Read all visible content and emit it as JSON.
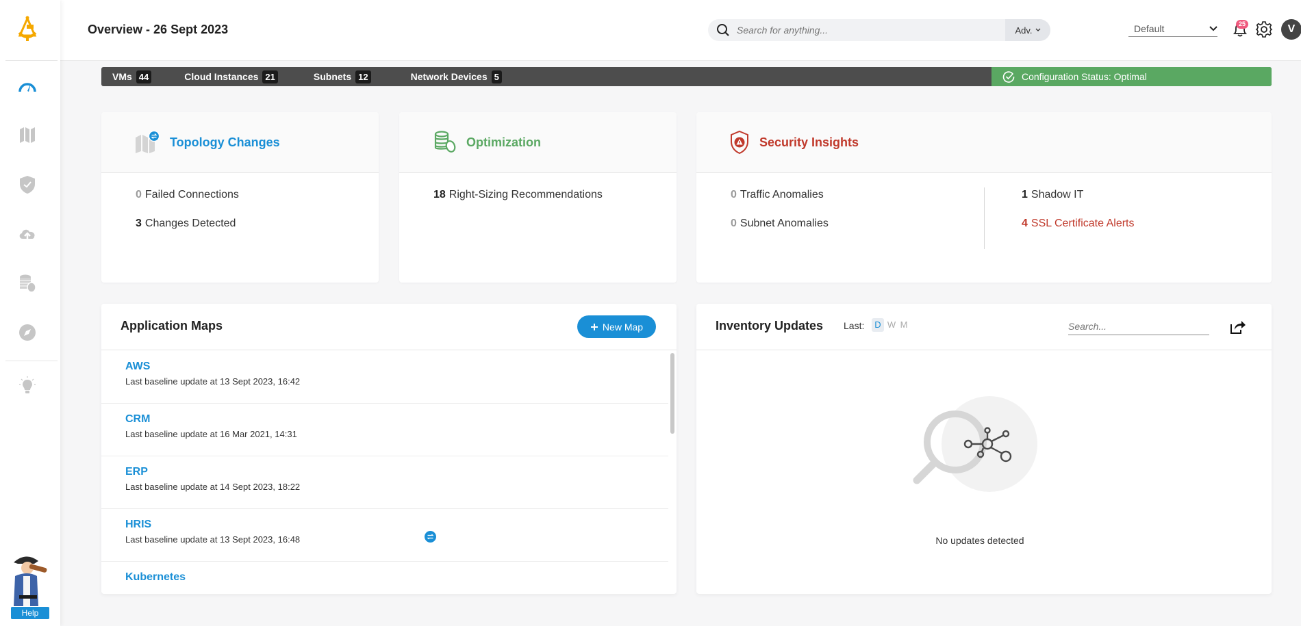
{
  "header": {
    "title": "Overview - 26 Sept 2023",
    "search_placeholder": "Search for anything...",
    "adv_label": "Adv.",
    "profile_select": "Default",
    "notification_count": "25",
    "avatar_initial": "V"
  },
  "sidebar": {
    "items": [
      {
        "icon": "dashboard-gauge-icon",
        "active": true
      },
      {
        "icon": "map-icon"
      },
      {
        "icon": "shield-check-icon"
      },
      {
        "icon": "cloud-upload-icon"
      },
      {
        "icon": "coins-icon"
      },
      {
        "icon": "compass-icon"
      },
      {
        "icon": "lightbulb-icon"
      }
    ],
    "help_label": "Help"
  },
  "stats_bar": {
    "items": [
      {
        "label": "VMs",
        "count": "44"
      },
      {
        "label": "Cloud Instances",
        "count": "21"
      },
      {
        "label": "Subnets",
        "count": "12"
      },
      {
        "label": "Network Devices",
        "count": "5"
      }
    ],
    "config_status": "Configuration Status: Optimal"
  },
  "cards": {
    "topology": {
      "title": "Topology Changes",
      "metrics": [
        {
          "value": "0",
          "label": "Failed Connections"
        },
        {
          "value": "3",
          "label": "Changes Detected"
        }
      ]
    },
    "optimization": {
      "title": "Optimization",
      "metrics": [
        {
          "value": "18",
          "label": "Right-Sizing Recommendations"
        }
      ]
    },
    "security": {
      "title": "Security Insights",
      "metrics": [
        {
          "value": "0",
          "label": "Traffic Anomalies"
        },
        {
          "value": "0",
          "label": "Subnet Anomalies"
        },
        {
          "value": "1",
          "label": "Shadow IT"
        },
        {
          "value": "4",
          "label": "SSL Certificate Alerts"
        }
      ]
    }
  },
  "app_maps": {
    "title": "Application Maps",
    "new_map_label": "New Map",
    "items": [
      {
        "name": "AWS",
        "subtitle": "Last baseline update at 13 Sept 2023, 16:42"
      },
      {
        "name": "CRM",
        "subtitle": "Last baseline update at 16 Mar 2021, 14:31"
      },
      {
        "name": "ERP",
        "subtitle": "Last baseline update at 14 Sept 2023, 18:22"
      },
      {
        "name": "HRIS",
        "subtitle": "Last baseline update at 13 Sept 2023, 16:48",
        "has_changes": true
      },
      {
        "name": "Kubernetes",
        "subtitle": ""
      }
    ]
  },
  "inventory": {
    "title": "Inventory Updates",
    "last_label": "Last:",
    "ranges": [
      "D",
      "W",
      "M"
    ],
    "active_range": "D",
    "search_placeholder": "Search...",
    "empty_message": "No updates detected"
  },
  "colors": {
    "accent": "#1a8fd6",
    "optimization": "#5aa862",
    "security": "#c0392b",
    "stats_bar": "#4d4d4d",
    "config_ok": "#5aa862",
    "notification_badge": "#f05a7e"
  }
}
